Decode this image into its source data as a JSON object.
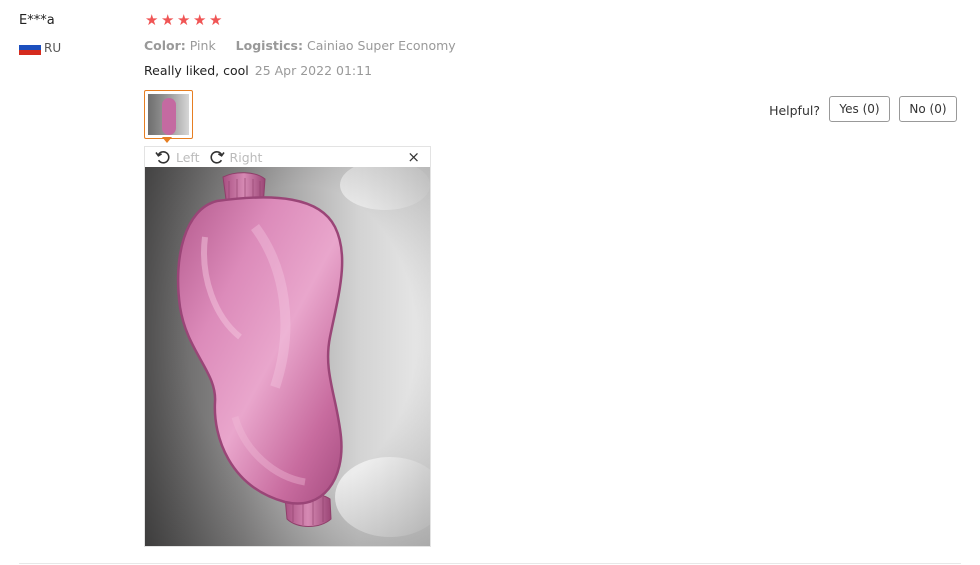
{
  "reviewer": {
    "name": "E***a",
    "country_code": "RU"
  },
  "rating": {
    "stars": 5,
    "max": 5,
    "color": "#f05555"
  },
  "meta": {
    "color_label": "Color:",
    "color_value": "Pink",
    "logistics_label": "Logistics:",
    "logistics_value": "Cainiao Super Economy"
  },
  "review": {
    "text": "Really liked, cool",
    "date": "25 Apr 2022 01:11"
  },
  "helpful": {
    "label": "Helpful?",
    "yes": "Yes (0)",
    "no": "No (0)"
  },
  "viewer": {
    "rotate_left": "Left",
    "rotate_right": "Right",
    "close": "×"
  },
  "icons": [
    "rotate-left-icon",
    "rotate-right-icon",
    "close-icon",
    "star-icon",
    "flag-ru-icon"
  ],
  "colors": {
    "accent": "#e67e22",
    "star": "#f05555",
    "mask": "#d07aa9"
  }
}
